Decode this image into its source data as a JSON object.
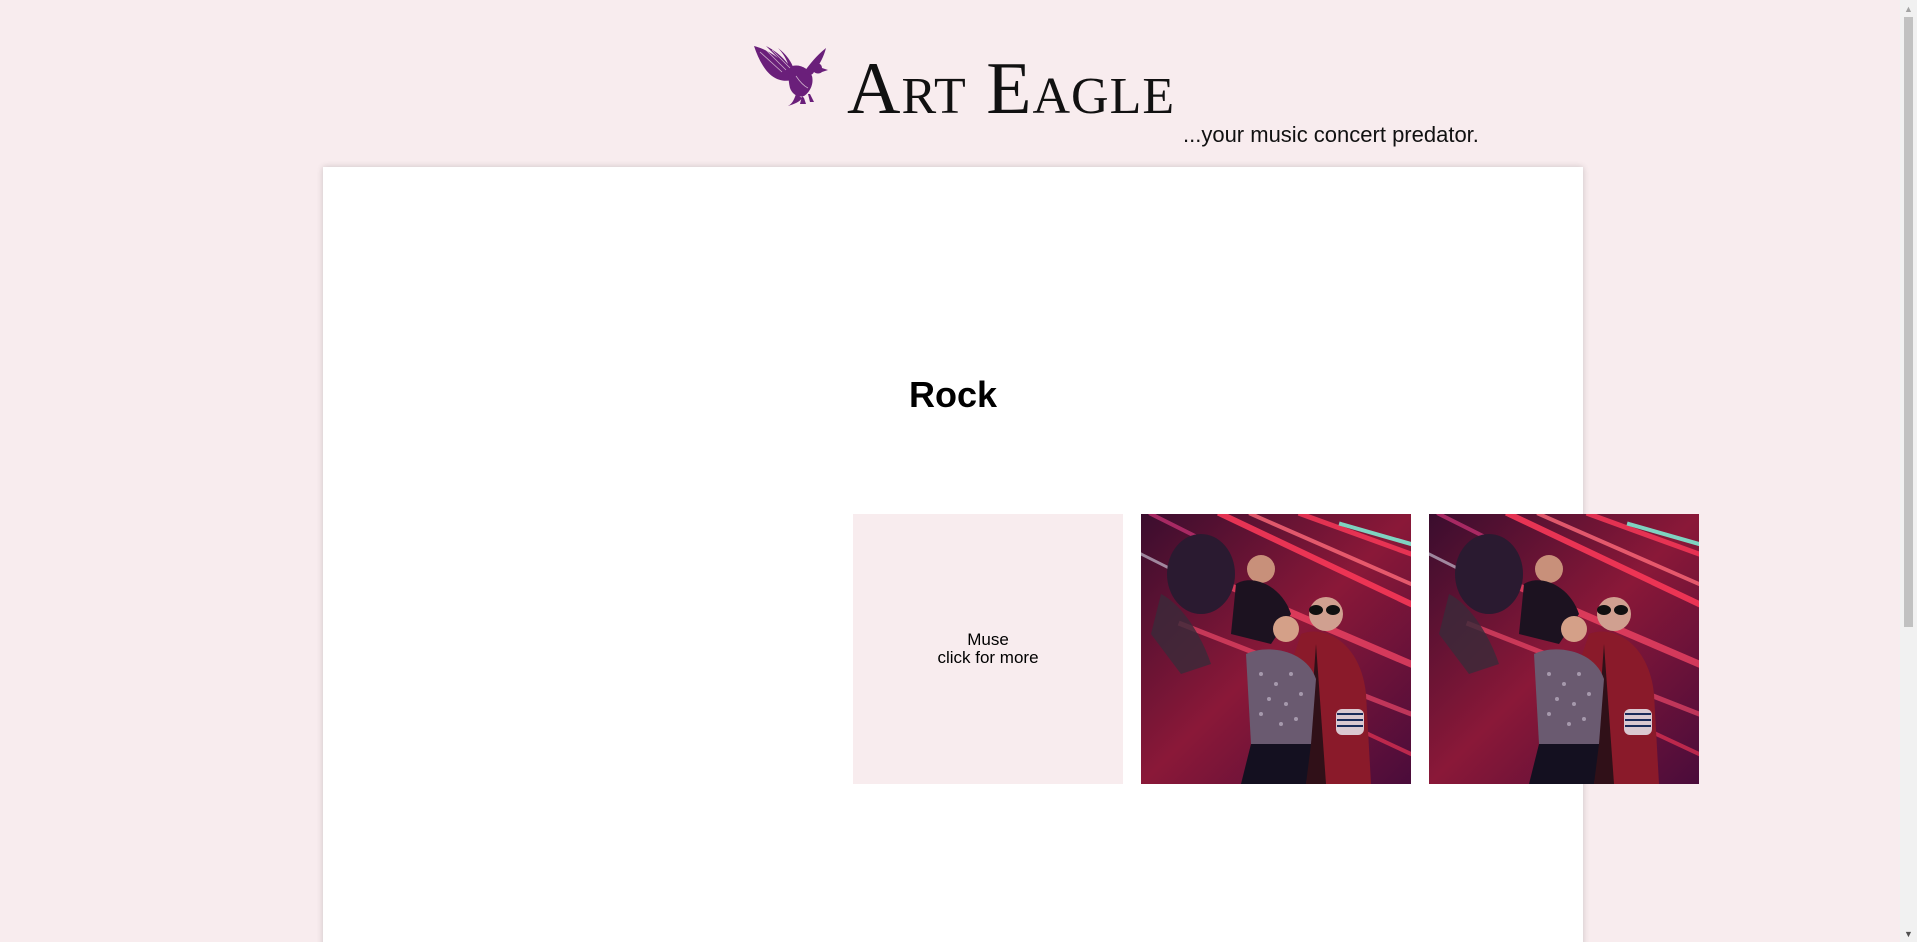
{
  "header": {
    "title": "Art Eagle",
    "tagline": "...your music concert predator.",
    "logo_icon": "eagle-icon",
    "logo_color": "#6a1f7a"
  },
  "main": {
    "category": "Rock",
    "tiles": [
      {
        "type": "text",
        "band": "Muse",
        "cta": "click for more"
      },
      {
        "type": "photo",
        "image": "band-photo"
      },
      {
        "type": "photo",
        "image": "band-photo"
      }
    ]
  },
  "colors": {
    "page_background": "#f8ecee",
    "card_background": "#ffffff",
    "tile_background": "#f8ecee"
  }
}
